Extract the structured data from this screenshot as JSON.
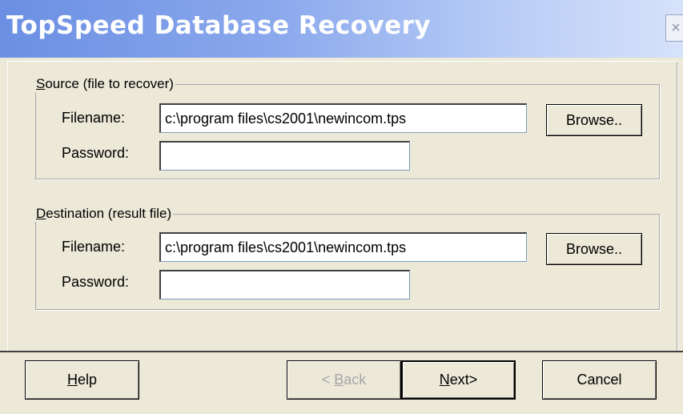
{
  "window": {
    "title": "TopSpeed Database Recovery",
    "close_glyph": "×"
  },
  "source": {
    "legend_first": "S",
    "legend_rest": "ource (file to recover)",
    "filename_label": "Filename:",
    "filename_value": "c:\\program files\\cs2001\\newincom.tps",
    "password_label": "Password:",
    "password_value": "",
    "browse_label": "Browse.."
  },
  "destination": {
    "legend_first": "D",
    "legend_rest": "estination (result file)",
    "filename_label": "Filename:",
    "filename_value": "c:\\program files\\cs2001\\newincom.tps",
    "password_label": "Password:",
    "password_value": "",
    "browse_label": "Browse.."
  },
  "buttons": {
    "help_first": "H",
    "help_rest": "elp",
    "back_prefix": "< ",
    "back_first": "B",
    "back_rest": "ack",
    "next_first": "N",
    "next_rest": "ext>",
    "cancel": "Cancel"
  }
}
